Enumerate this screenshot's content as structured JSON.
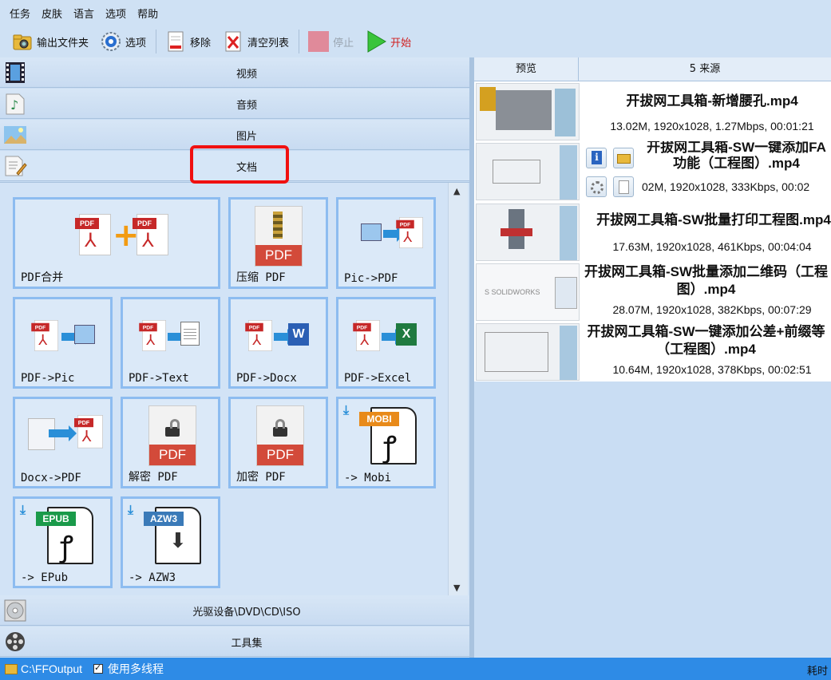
{
  "menu": [
    "任务",
    "皮肤",
    "语言",
    "选项",
    "帮助"
  ],
  "toolbar": {
    "output_folder": "输出文件夹",
    "options": "选项",
    "remove": "移除",
    "clear_list": "清空列表",
    "stop": "停止",
    "start": "开始"
  },
  "categories": {
    "video": "视频",
    "audio": "音频",
    "image": "图片",
    "document": "文档",
    "rom": "光驱设备\\DVD\\CD\\ISO",
    "tools": "工具集"
  },
  "tiles": [
    "PDF合并",
    "压缩 PDF",
    "Pic->PDF",
    "PDF->Pic",
    "PDF->Text",
    "PDF->Docx",
    "PDF->Excel",
    "Docx->PDF",
    "解密 PDF",
    "加密 PDF",
    "-> Mobi",
    "-> EPub",
    "-> AZW3"
  ],
  "icon_labels": {
    "pdf": "PDF",
    "mobi": "MOBI",
    "epub": "EPUB",
    "azw3": "AZW3"
  },
  "right": {
    "preview_header": "预览",
    "source_header": "5 来源",
    "files": [
      {
        "name": "开拔网工具箱-新增腰孔.mp4",
        "info": "13.02M, 1920x1028, 1.27Mbps, 00:01:21"
      },
      {
        "name": "开拔网工具箱-SW一键添加FA功能（工程图）.mp4",
        "info": "02M, 1920x1028, 333Kbps, 00:02"
      },
      {
        "name": "开拔网工具箱-SW批量打印工程图.mp4",
        "info": "17.63M, 1920x1028, 461Kbps, 00:04:04"
      },
      {
        "name": "开拔网工具箱-SW批量添加二维码（工程图）.mp4",
        "info": "28.07M, 1920x1028, 382Kbps, 00:07:29"
      },
      {
        "name": "开拔网工具箱-SW一键添加公差+前缀等（工程图）.mp4",
        "info": "10.64M, 1920x1028, 378Kbps, 00:02:51"
      }
    ]
  },
  "status": {
    "output_path": "C:\\FFOutput",
    "multithread": "使用多线程",
    "elapsed": "耗时"
  },
  "colors": {
    "highlight_border": "#f01010",
    "status_bar": "#2e8be6",
    "tile_border": "#8dbcf0"
  }
}
